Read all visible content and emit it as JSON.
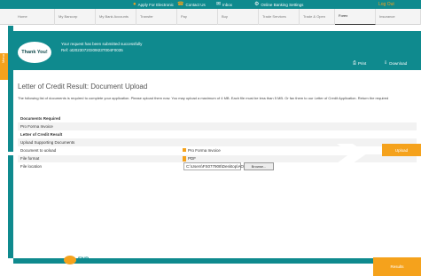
{
  "topbar": {
    "links": [
      {
        "icon": "location-pin-icon",
        "label": "Apply For Electronic"
      },
      {
        "icon": "phone-icon",
        "label": "Contact Us"
      },
      {
        "icon": "mail-icon",
        "label": "Inbox"
      },
      {
        "icon": "gear-icon",
        "label": "Online Banking Settings"
      }
    ],
    "logoff": "Log Out"
  },
  "nav": {
    "items": [
      "Home",
      "My Bancorp",
      "My Bank Accounts",
      "Transfer",
      "Pay",
      "Buy",
      "Trade Services",
      "Trade & Open",
      "Forex",
      "Insurance"
    ],
    "active_index": 8
  },
  "side_tab": "Menu",
  "banner": {
    "bubble": "Thank You!",
    "line1": "Your request has been submitted successfully",
    "line2": "Ref: ot2023072GI09I23T004F0035"
  },
  "actions": {
    "print": "Print",
    "download": "Download"
  },
  "page": {
    "title": "Letter of Credit Result: Document Upload",
    "intro": "The following list of documents is required to complete your application. Please upload them now. You may upload a maximum of 4 MB. Each file must be less than 5 MB. Or fax them to our Letter of Credit Application. Return the required",
    "rows": [
      {
        "label": "Documents Required",
        "bold": true,
        "stripe": false
      },
      {
        "label": "Pro Forma Invoice",
        "bold": false,
        "stripe": true
      },
      {
        "label": "Letter of Credit Result",
        "bold": true,
        "stripe": false
      },
      {
        "label": "Upload Supporting Documents",
        "bold": false,
        "stripe": true
      }
    ],
    "fields": {
      "doc_label": "Document to upload",
      "doc_value": "Pro Forma Invoice",
      "format_label": "File format",
      "format_value": "PDF",
      "location_label": "File location",
      "location_value": "C:\\Users\\FS077908\\Desktop\\AO",
      "browse": "Browse..."
    },
    "upload": "Upload"
  },
  "footer": {
    "logo": "FNB",
    "results": "Results"
  },
  "colors": {
    "teal": "#0f8a8e",
    "orange": "#f5a21c"
  }
}
